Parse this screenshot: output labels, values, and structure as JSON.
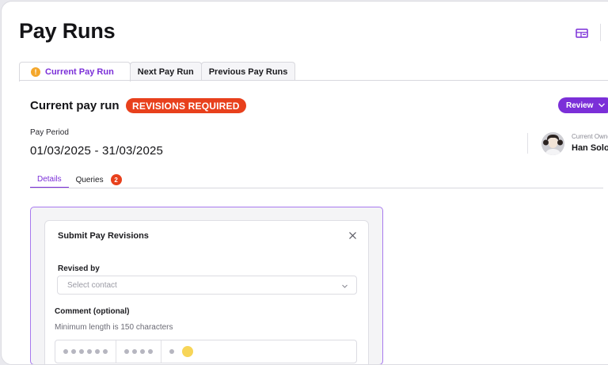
{
  "page": {
    "title": "Pay Runs"
  },
  "header": {
    "icons": [
      "table-view-icon"
    ]
  },
  "tabs": [
    {
      "label": "Current Pay Run",
      "active": true,
      "warning_icon": "!"
    },
    {
      "label": "Next Pay Run",
      "active": false
    },
    {
      "label": "Previous Pay Runs",
      "active": false
    }
  ],
  "pay_run": {
    "title": "Current pay run",
    "status": "REVISIONS REQUIRED",
    "review_label": "Review",
    "pay_period_label": "Pay Period",
    "pay_period_value": "01/03/2025 - 31/03/2025",
    "owner_label": "Current Owner",
    "owner_name": "Han Solo"
  },
  "subtabs": [
    {
      "label": "Details",
      "active": true
    },
    {
      "label": "Queries",
      "active": false,
      "count": "2"
    }
  ],
  "modal": {
    "title": "Submit Pay Revisions",
    "revised_by_label": "Revised by",
    "contact_placeholder": "Select contact",
    "comment_label": "Comment (optional)",
    "comment_hint": "Minimum length is 150 characters"
  },
  "colors": {
    "accent": "#7b2fd8",
    "status_red": "#e8401c",
    "warning_orange": "#f4a72b"
  }
}
